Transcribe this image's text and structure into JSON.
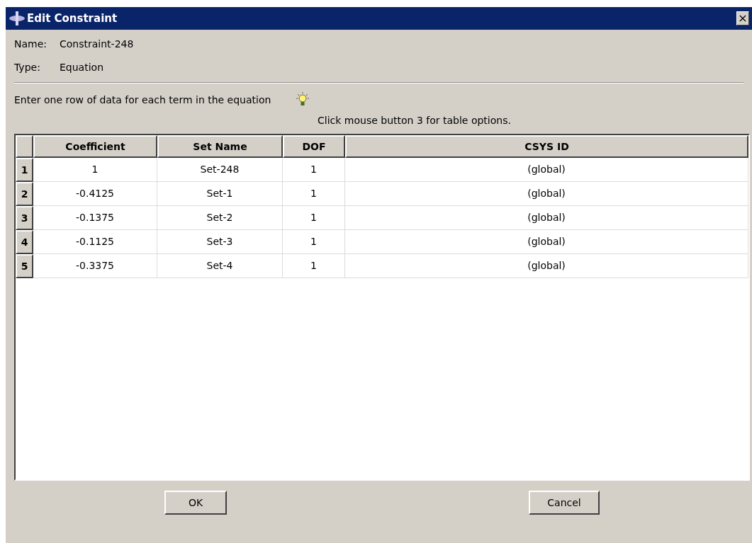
{
  "window": {
    "title": "Edit Constraint",
    "close": "×"
  },
  "fields": [
    {
      "label": "Name:",
      "value": "Constraint-248"
    },
    {
      "label": "Type:",
      "value": "Equation"
    }
  ],
  "instruction": "Enter one row of data for each term in the equation",
  "hint": "Click mouse button 3 for table options.",
  "table": {
    "columns": [
      "Coefficient",
      "Set Name",
      "DOF",
      "CSYS ID"
    ],
    "rows": [
      {
        "number": "1",
        "cells": [
          "1",
          "Set-248",
          "1",
          "(global)"
        ]
      },
      {
        "number": "2",
        "cells": [
          "-0.4125",
          "Set-1",
          "1",
          "(global)"
        ]
      },
      {
        "number": "3",
        "cells": [
          "-0.1375",
          "Set-2",
          "1",
          "(global)"
        ]
      },
      {
        "number": "4",
        "cells": [
          "-0.1125",
          "Set-3",
          "1",
          "(global)"
        ]
      },
      {
        "number": "5",
        "cells": [
          "-0.3375",
          "Set-4",
          "1",
          "(global)"
        ]
      }
    ]
  },
  "buttons": [
    "OK",
    "Cancel"
  ]
}
